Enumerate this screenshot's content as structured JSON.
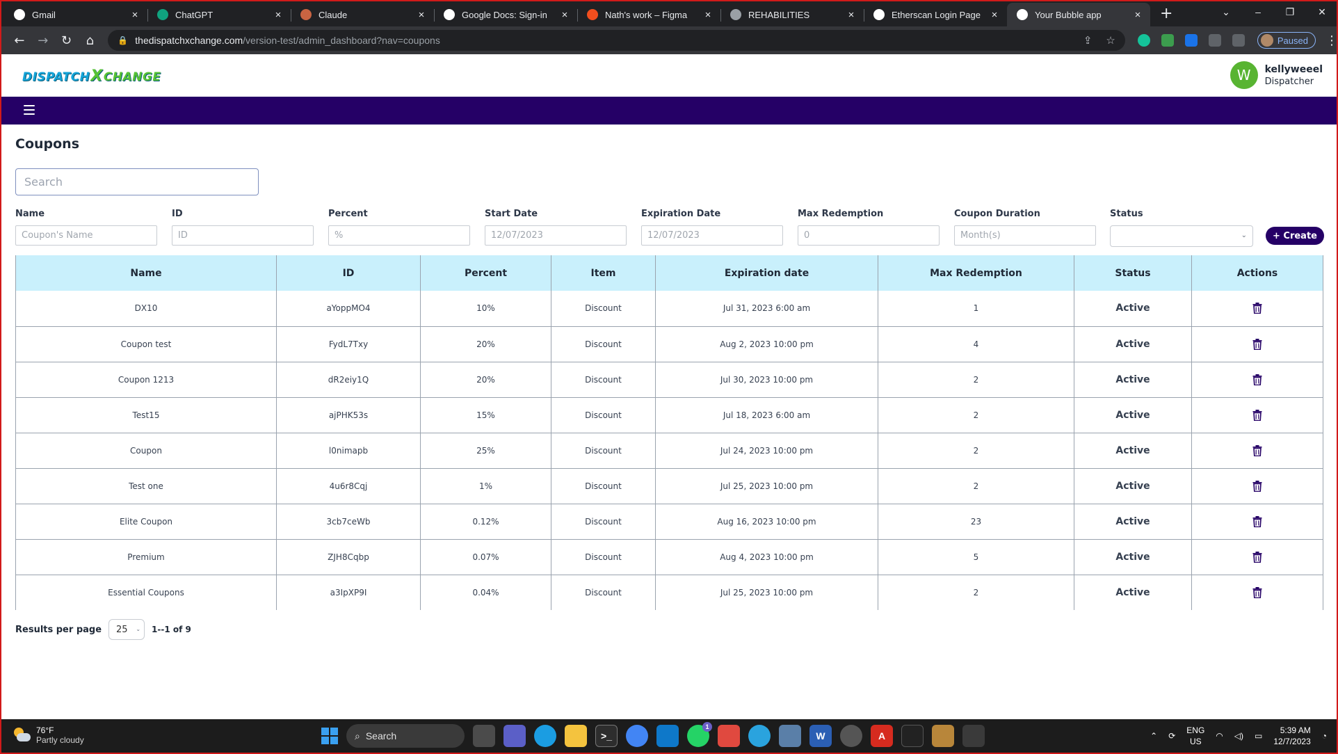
{
  "browser": {
    "tabs": [
      {
        "title": "Gmail",
        "icon": "google-icon",
        "color": "#ffffff"
      },
      {
        "title": "ChatGPT",
        "icon": "chatgpt-icon",
        "color": "#10a37f"
      },
      {
        "title": "Claude",
        "icon": "claude-icon",
        "color": "#c96442"
      },
      {
        "title": "Google Docs: Sign-in",
        "icon": "google-icon",
        "color": "#ffffff"
      },
      {
        "title": "Nath's work – Figma",
        "icon": "figma-icon",
        "color": "#f24e1e"
      },
      {
        "title": "REHABILITIES",
        "icon": "globe-icon",
        "color": "#9aa0a6"
      },
      {
        "title": "Etherscan Login Page",
        "icon": "etherscan-icon",
        "color": "#ffffff"
      },
      {
        "title": "Your Bubble app",
        "icon": "bubble-icon",
        "color": "#ffffff"
      }
    ],
    "url_host": "thedispatchxchange.com",
    "url_path": "/version-test/admin_dashboard?nav=coupons",
    "profile_status": "Paused"
  },
  "app": {
    "logo_main": "DISPATCH",
    "logo_x": "X",
    "logo_tail": "CHANGE",
    "user": {
      "initial": "W",
      "name": "kellyweeel",
      "role": "Dispatcher"
    },
    "page_title": "Coupons",
    "search_placeholder": "Search"
  },
  "filters": {
    "name": {
      "label": "Name",
      "placeholder": "Coupon's Name"
    },
    "id": {
      "label": "ID",
      "placeholder": "ID"
    },
    "percent": {
      "label": "Percent",
      "placeholder": "%"
    },
    "start_date": {
      "label": "Start Date",
      "placeholder": "12/07/2023"
    },
    "expiration_date": {
      "label": "Expiration Date",
      "placeholder": "12/07/2023"
    },
    "max_redemption": {
      "label": "Max Redemption",
      "placeholder": "0"
    },
    "coupon_duration": {
      "label": "Coupon Duration",
      "placeholder": "Month(s)"
    },
    "status": {
      "label": "Status",
      "value": ""
    },
    "create_label": "+ Create"
  },
  "table": {
    "columns": [
      "Name",
      "ID",
      "Percent",
      "Item",
      "Expiration date",
      "Max Redemption",
      "Status",
      "Actions"
    ],
    "rows": [
      {
        "name": "DX10",
        "id": "aYoppMO4",
        "percent": "10%",
        "item": "Discount",
        "expiration": "Jul 31, 2023 6:00 am",
        "max_redemption": "1",
        "status": "Active"
      },
      {
        "name": "Coupon test",
        "id": "FydL7Txy",
        "percent": "20%",
        "item": "Discount",
        "expiration": "Aug 2, 2023 10:00 pm",
        "max_redemption": "4",
        "status": "Active"
      },
      {
        "name": "Coupon 1213",
        "id": "dR2eiy1Q",
        "percent": "20%",
        "item": "Discount",
        "expiration": "Jul 30, 2023 10:00 pm",
        "max_redemption": "2",
        "status": "Active"
      },
      {
        "name": "Test15",
        "id": "ajPHK53s",
        "percent": "15%",
        "item": "Discount",
        "expiration": "Jul 18, 2023 6:00 am",
        "max_redemption": "2",
        "status": "Active"
      },
      {
        "name": "Coupon",
        "id": "l0nimapb",
        "percent": "25%",
        "item": "Discount",
        "expiration": "Jul 24, 2023 10:00 pm",
        "max_redemption": "2",
        "status": "Active"
      },
      {
        "name": "Test one",
        "id": "4u6r8Cqj",
        "percent": "1%",
        "item": "Discount",
        "expiration": "Jul 25, 2023 10:00 pm",
        "max_redemption": "2",
        "status": "Active"
      },
      {
        "name": "Elite Coupon",
        "id": "3cb7ceWb",
        "percent": "0.12%",
        "item": "Discount",
        "expiration": "Aug 16, 2023 10:00 pm",
        "max_redemption": "23",
        "status": "Active"
      },
      {
        "name": "Premium",
        "id": "ZJH8Cqbp",
        "percent": "0.07%",
        "item": "Discount",
        "expiration": "Aug 4, 2023 10:00 pm",
        "max_redemption": "5",
        "status": "Active"
      },
      {
        "name": "Essential Coupons",
        "id": "a3IpXP9I",
        "percent": "0.04%",
        "item": "Discount",
        "expiration": "Jul 25, 2023 10:00 pm",
        "max_redemption": "2",
        "status": "Active"
      }
    ],
    "action_icon": "trash-icon"
  },
  "pagination": {
    "label": "Results per page",
    "per_page": "25",
    "range": "1--1 of 9"
  },
  "taskbar": {
    "temperature": "76°F",
    "weather": "Partly cloudy",
    "search_label": "Search",
    "language": "ENG",
    "region": "US",
    "time": "5:39 AM",
    "date": "12/7/2023",
    "whatsapp_badge": "1"
  },
  "colors": {
    "brand_purple": "#250066",
    "header_cyan": "#c9f0fc",
    "avatar_green": "#58b432"
  }
}
